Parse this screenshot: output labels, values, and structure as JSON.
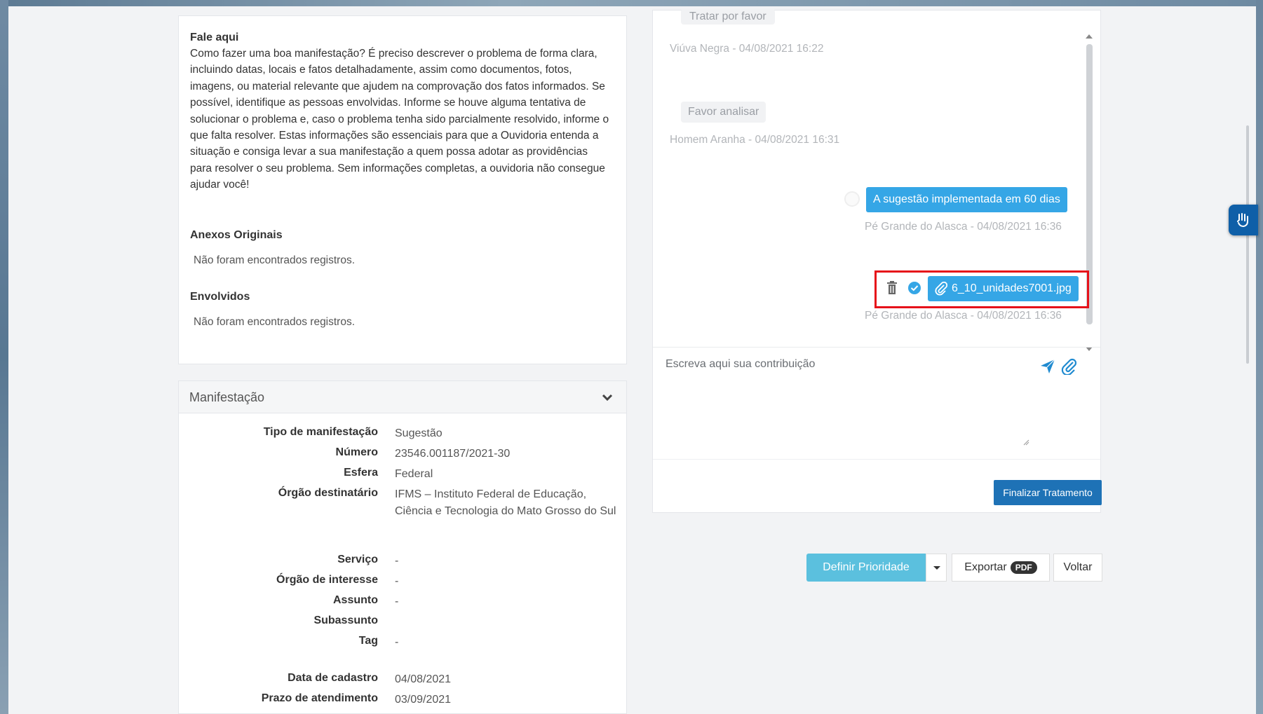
{
  "fale_aqui": {
    "title": "Fale aqui",
    "text": "Como fazer uma boa manifestação? É preciso descrever o problema de forma clara, incluindo datas, locais e fatos detalhadamente, assim como documentos, fotos, imagens, ou material relevante que ajudem na comprovação dos fatos informados. Se possível, identifique as pessoas envolvidas. Informe se houve alguma tentativa de solucionar o problema e, caso o problema tenha sido parcialmente resolvido, informe o que falta resolver. Estas informações são essenciais para que a Ouvidoria entenda a situação e consiga levar a sua manifestação a quem possa adotar as providências para resolver o seu problema. Sem informações completas, a ouvidoria não consegue ajudar você!"
  },
  "anexos": {
    "title": "Anexos Originais",
    "empty": "Não foram encontrados registros."
  },
  "envolvidos": {
    "title": "Envolvidos",
    "empty": "Não foram encontrados registros."
  },
  "manifestacao": {
    "title": "Manifestação",
    "fields": [
      {
        "label": "Tipo de manifestação",
        "value": "Sugestão"
      },
      {
        "label": "Número",
        "value": "23546.001187/2021-30"
      },
      {
        "label": "Esfera",
        "value": "Federal"
      },
      {
        "label": "Órgão destinatário",
        "value": "IFMS – Instituto Federal de Educação, Ciência e Tecnologia do Mato Grosso do Sul"
      },
      {
        "label": "Serviço",
        "value": "-"
      },
      {
        "label": "Órgão de interesse",
        "value": "-"
      },
      {
        "label": "Assunto",
        "value": "-"
      },
      {
        "label": "Subassunto",
        "value": ""
      },
      {
        "label": "Tag",
        "value": "-"
      },
      {
        "label": "Data de cadastro",
        "value": "04/08/2021"
      },
      {
        "label": "Prazo de atendimento",
        "value": "03/09/2021"
      }
    ]
  },
  "chat": {
    "messages": [
      {
        "text": "Tratar por favor",
        "meta": "Viúva Negra - 04/08/2021 16:22"
      },
      {
        "text": "Favor analisar",
        "meta": "Homem Aranha - 04/08/2021 16:31"
      },
      {
        "text": "A sugestão implementada em 60 dias",
        "meta": "Pé Grande do Alasca - 04/08/2021 16:36"
      },
      {
        "text": "6_10_unidades7001.jpg",
        "meta": "Pé Grande do Alasca - 04/08/2021 16:36"
      }
    ],
    "input_placeholder": "Escreva aqui sua contribuição",
    "finalize_label": "Finalizar Tratamento"
  },
  "actions": {
    "priority_label": "Definir Prioridade",
    "export_label": "Exportar",
    "export_badge": "PDF",
    "back_label": "Voltar"
  }
}
